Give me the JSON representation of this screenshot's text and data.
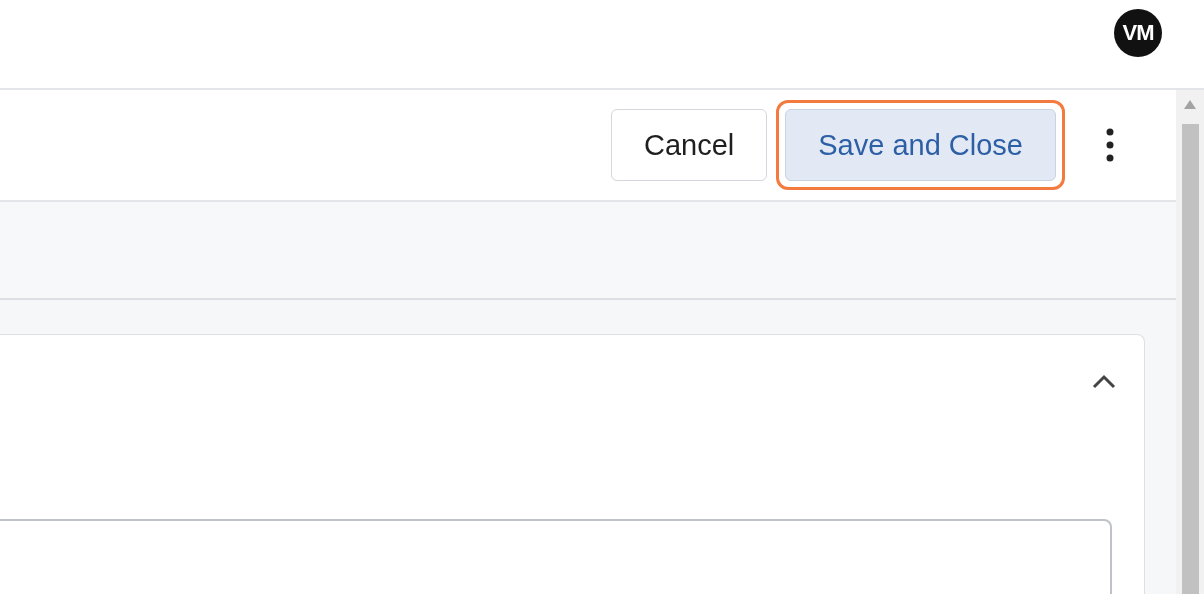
{
  "user": {
    "initials": "VM"
  },
  "toolbar": {
    "buttons": [
      {
        "label": "Cancel",
        "kind": "secondary",
        "highlighted": false
      },
      {
        "label": "Save and Close",
        "kind": "primary",
        "highlighted": true
      }
    ]
  },
  "card": {
    "expanded": true
  }
}
